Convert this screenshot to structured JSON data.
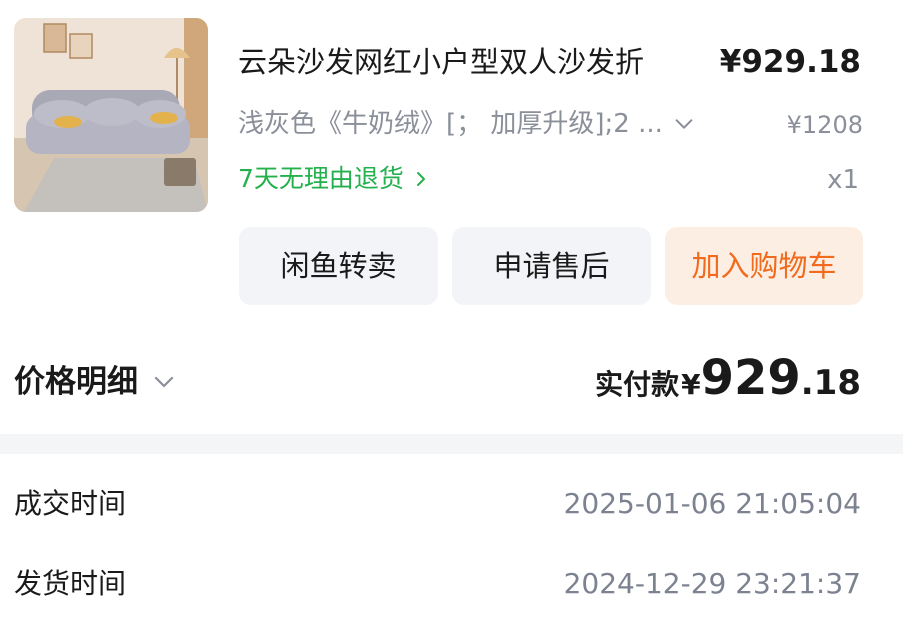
{
  "product": {
    "image_icon": "sofa-photo",
    "title": "云朵沙发网红小户型双人沙发折",
    "price": "¥929.18",
    "spec": "浅灰色《牛奶绒》[； 加厚升级];2 ...",
    "original_price": "¥1208",
    "return_policy": "7天无理由退货",
    "quantity": "x1"
  },
  "actions": {
    "resell_label": "闲鱼转卖",
    "aftersale_label": "申请售后",
    "add_to_cart_label": "加入购物车"
  },
  "summary": {
    "price_detail_label": "价格明细",
    "paid_label": "实付款",
    "currency": "¥",
    "paid_integer": "929",
    "paid_decimal": ".18"
  },
  "details": [
    {
      "label": "成交时间",
      "value": "2025-01-06 21:05:04"
    },
    {
      "label": "发货时间",
      "value": "2024-12-29 23:21:37"
    }
  ],
  "colors": {
    "green": "#23b04d",
    "orange": "#f26b1d",
    "orange_bg": "#fdeee3",
    "gray_text": "#8a8f99",
    "button_bg": "#f2f4f7"
  }
}
